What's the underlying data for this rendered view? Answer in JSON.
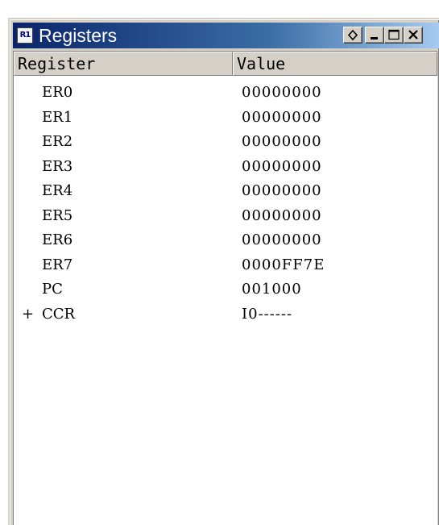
{
  "window": {
    "title": "Registers",
    "icon_label": "R1",
    "icon_name": "registers-window-icon",
    "title_gradient": [
      "#0a246a",
      "#a6caf0"
    ]
  },
  "table": {
    "columns": [
      "Register",
      "Value"
    ],
    "rows": [
      {
        "expander": "",
        "name": "ER0",
        "value": "00000000"
      },
      {
        "expander": "",
        "name": "ER1",
        "value": "00000000"
      },
      {
        "expander": "",
        "name": "ER2",
        "value": "00000000"
      },
      {
        "expander": "",
        "name": "ER3",
        "value": "00000000"
      },
      {
        "expander": "",
        "name": "ER4",
        "value": "00000000"
      },
      {
        "expander": "",
        "name": "ER5",
        "value": "00000000"
      },
      {
        "expander": "",
        "name": "ER6",
        "value": "00000000"
      },
      {
        "expander": "",
        "name": "ER7",
        "value": "0000FF7E"
      },
      {
        "expander": "",
        "name": "PC",
        "value": "001000"
      },
      {
        "expander": "+",
        "name": "CCR",
        "value": "I0------"
      }
    ]
  }
}
